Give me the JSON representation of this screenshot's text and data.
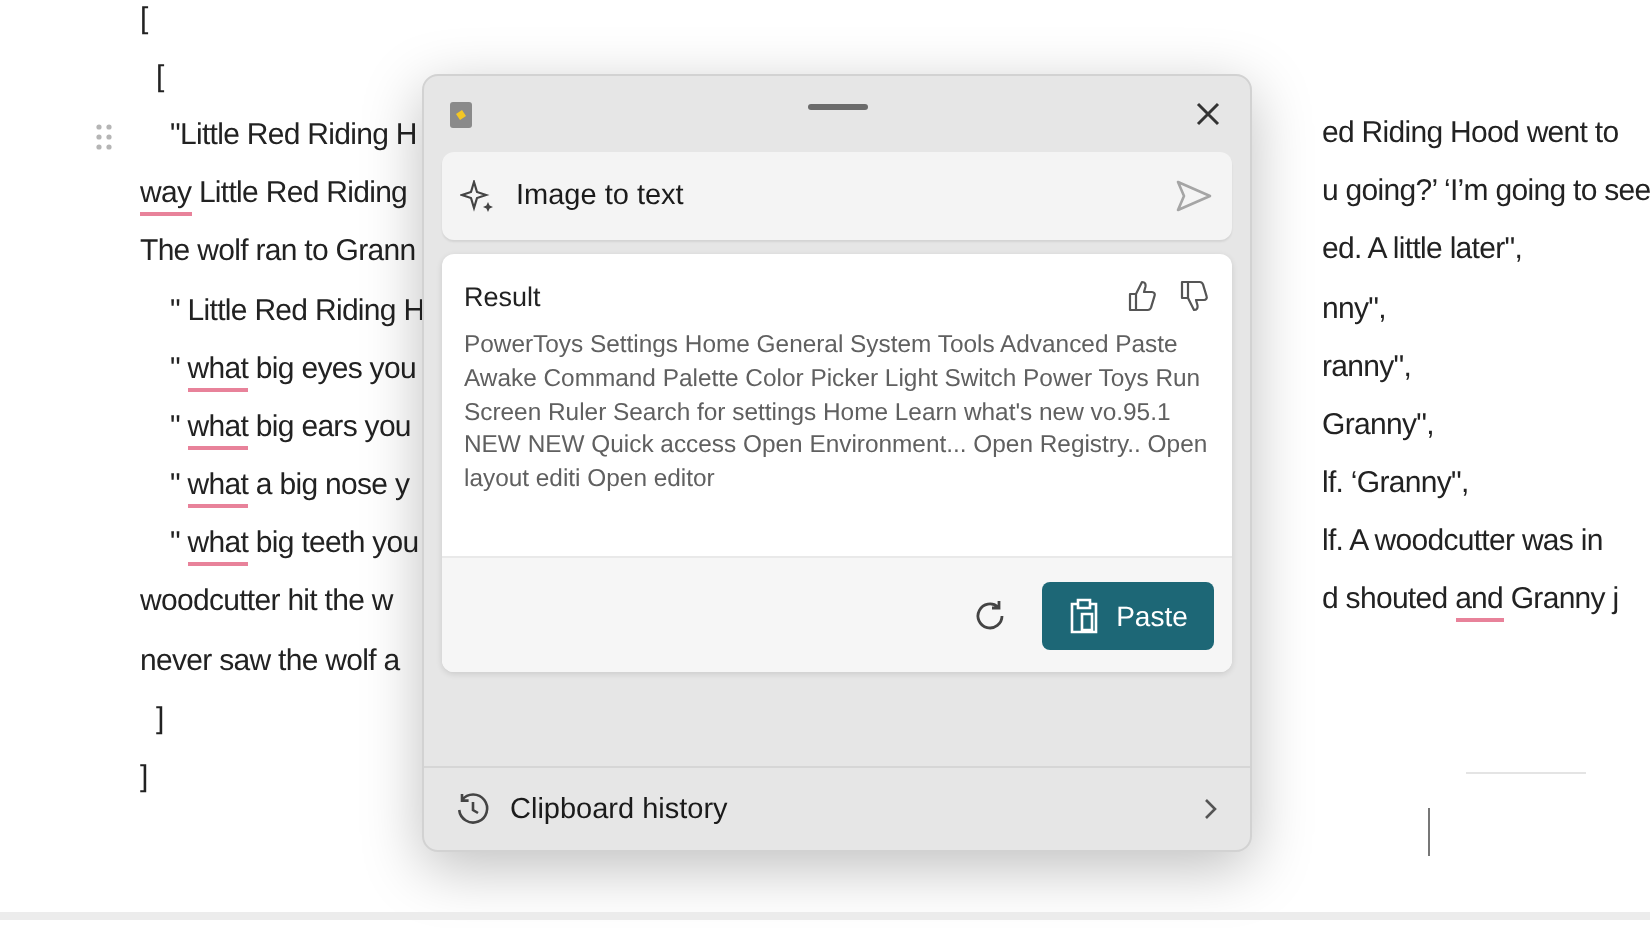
{
  "document": {
    "lines": [
      {
        "kind": "outer",
        "left": [
          {
            "text": "[",
            "misspelled": false
          }
        ]
      },
      {
        "kind": "inner",
        "left": [
          {
            "text": "[",
            "misspelled": false
          }
        ]
      },
      {
        "kind": "item",
        "handle": true,
        "left": [
          {
            "text": "\"Little Red Riding H",
            "misspelled": false
          }
        ],
        "right": [
          {
            "text": "ed Riding Hood went to",
            "misspelled": false
          }
        ]
      },
      {
        "kind": "wrap",
        "left": [
          {
            "text": "way",
            "misspelled": true
          },
          {
            "text": " Little Red Riding",
            "misspelled": false
          }
        ],
        "right": [
          {
            "text": "u going?’ ‘I’m going to see",
            "misspelled": false
          }
        ]
      },
      {
        "kind": "wrap",
        "left": [
          {
            "text": "The wolf ran to Grann",
            "misspelled": false
          }
        ],
        "right": [
          {
            "text": "ed. A little later\",",
            "misspelled": false
          }
        ]
      },
      {
        "kind": "item",
        "left": [
          {
            "text": "\" Little Red Riding H",
            "misspelled": false
          }
        ],
        "right": [
          {
            "text": "nny\",",
            "misspelled": false
          }
        ]
      },
      {
        "kind": "item",
        "left": [
          {
            "text": "\" ",
            "misspelled": false
          },
          {
            "text": "what",
            "misspelled": true
          },
          {
            "text": " big eyes you",
            "misspelled": false
          }
        ],
        "right": [
          {
            "text": "ranny\",",
            "misspelled": false
          }
        ]
      },
      {
        "kind": "item",
        "left": [
          {
            "text": "\" ",
            "misspelled": false
          },
          {
            "text": "what",
            "misspelled": true
          },
          {
            "text": " big ears you",
            "misspelled": false
          }
        ],
        "right": [
          {
            "text": "Granny\",",
            "misspelled": false
          }
        ]
      },
      {
        "kind": "item",
        "left": [
          {
            "text": "\" ",
            "misspelled": false
          },
          {
            "text": "what",
            "misspelled": true
          },
          {
            "text": " a big nose y",
            "misspelled": false
          }
        ],
        "right": [
          {
            "text": "lf. ‘Granny\",",
            "misspelled": false
          }
        ]
      },
      {
        "kind": "item",
        "left": [
          {
            "text": "\" ",
            "misspelled": false
          },
          {
            "text": "what",
            "misspelled": true
          },
          {
            "text": " big teeth you",
            "misspelled": false
          }
        ],
        "right": [
          {
            "text": "lf. A woodcutter was in",
            "misspelled": false
          }
        ]
      },
      {
        "kind": "wrap",
        "left": [
          {
            "text": "woodcutter hit the w",
            "misspelled": false
          }
        ],
        "right": [
          {
            "text": "d shouted ",
            "misspelled": false
          },
          {
            "text": "and",
            "misspelled": true
          },
          {
            "text": " Granny j",
            "misspelled": false
          }
        ]
      },
      {
        "kind": "wrap",
        "left": [
          {
            "text": "never saw the wolf a",
            "misspelled": false
          }
        ]
      },
      {
        "kind": "inner",
        "left": [
          {
            "text": "]",
            "misspelled": false
          }
        ]
      },
      {
        "kind": "outer",
        "left": [
          {
            "text": "]",
            "misspelled": false
          }
        ]
      }
    ]
  },
  "popup": {
    "prompt": {
      "label": "Image to text"
    },
    "result": {
      "heading": "Result",
      "text": "PowerToys Settings Home General System Tools Advanced Paste Awake Command Palette Color Picker Light Switch Power Toys Run Screen Ruler Search for settings Home Learn what's new vo.95.1 NEW NEW Quick access Open Environment... Open Registry.. Open layout editi Open editor"
    },
    "paste_button": "Paste",
    "footer": {
      "label": "Clipboard history"
    }
  }
}
